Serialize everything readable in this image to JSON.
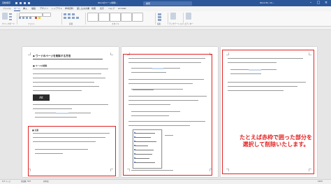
{
  "titlebar": {
    "autosave": "自動保存",
    "doc_name": "Wordのページ削除…",
    "search": "検索",
    "user": "Word Ex. Ch...",
    "accent": "#2b579a"
  },
  "window_controls": {
    "minimize": "–",
    "maximize": "□",
    "close": "×"
  },
  "tabs": [
    "ファイル",
    "ホーム",
    "挿入",
    "描画",
    "デザイン",
    "レイアウト",
    "参考資料",
    "差し込み文書",
    "校閲",
    "表示",
    "ヘルプ",
    "Acrobat"
  ],
  "ribbon_groups": [
    "クリップボード",
    "フォント",
    "段落",
    "スタイル",
    "編集",
    "ディクテーション",
    "エディター"
  ],
  "pages": [
    {
      "heading": "◆ ワードのページを削除する方法",
      "section1": "■ ページの削除",
      "section2": "■ 注意",
      "button_text": "Alt"
    },
    {
      "heading": ""
    },
    {
      "heading": ""
    }
  ],
  "annotation": {
    "line1": "たとえば赤枠で囲った部分を",
    "line2": "選択して削除いたします。",
    "color": "#e32222"
  },
  "status": {
    "page": "1/3 ページ",
    "words": "単語数: 523",
    "lang": "日本語",
    "zoom": "100%"
  }
}
